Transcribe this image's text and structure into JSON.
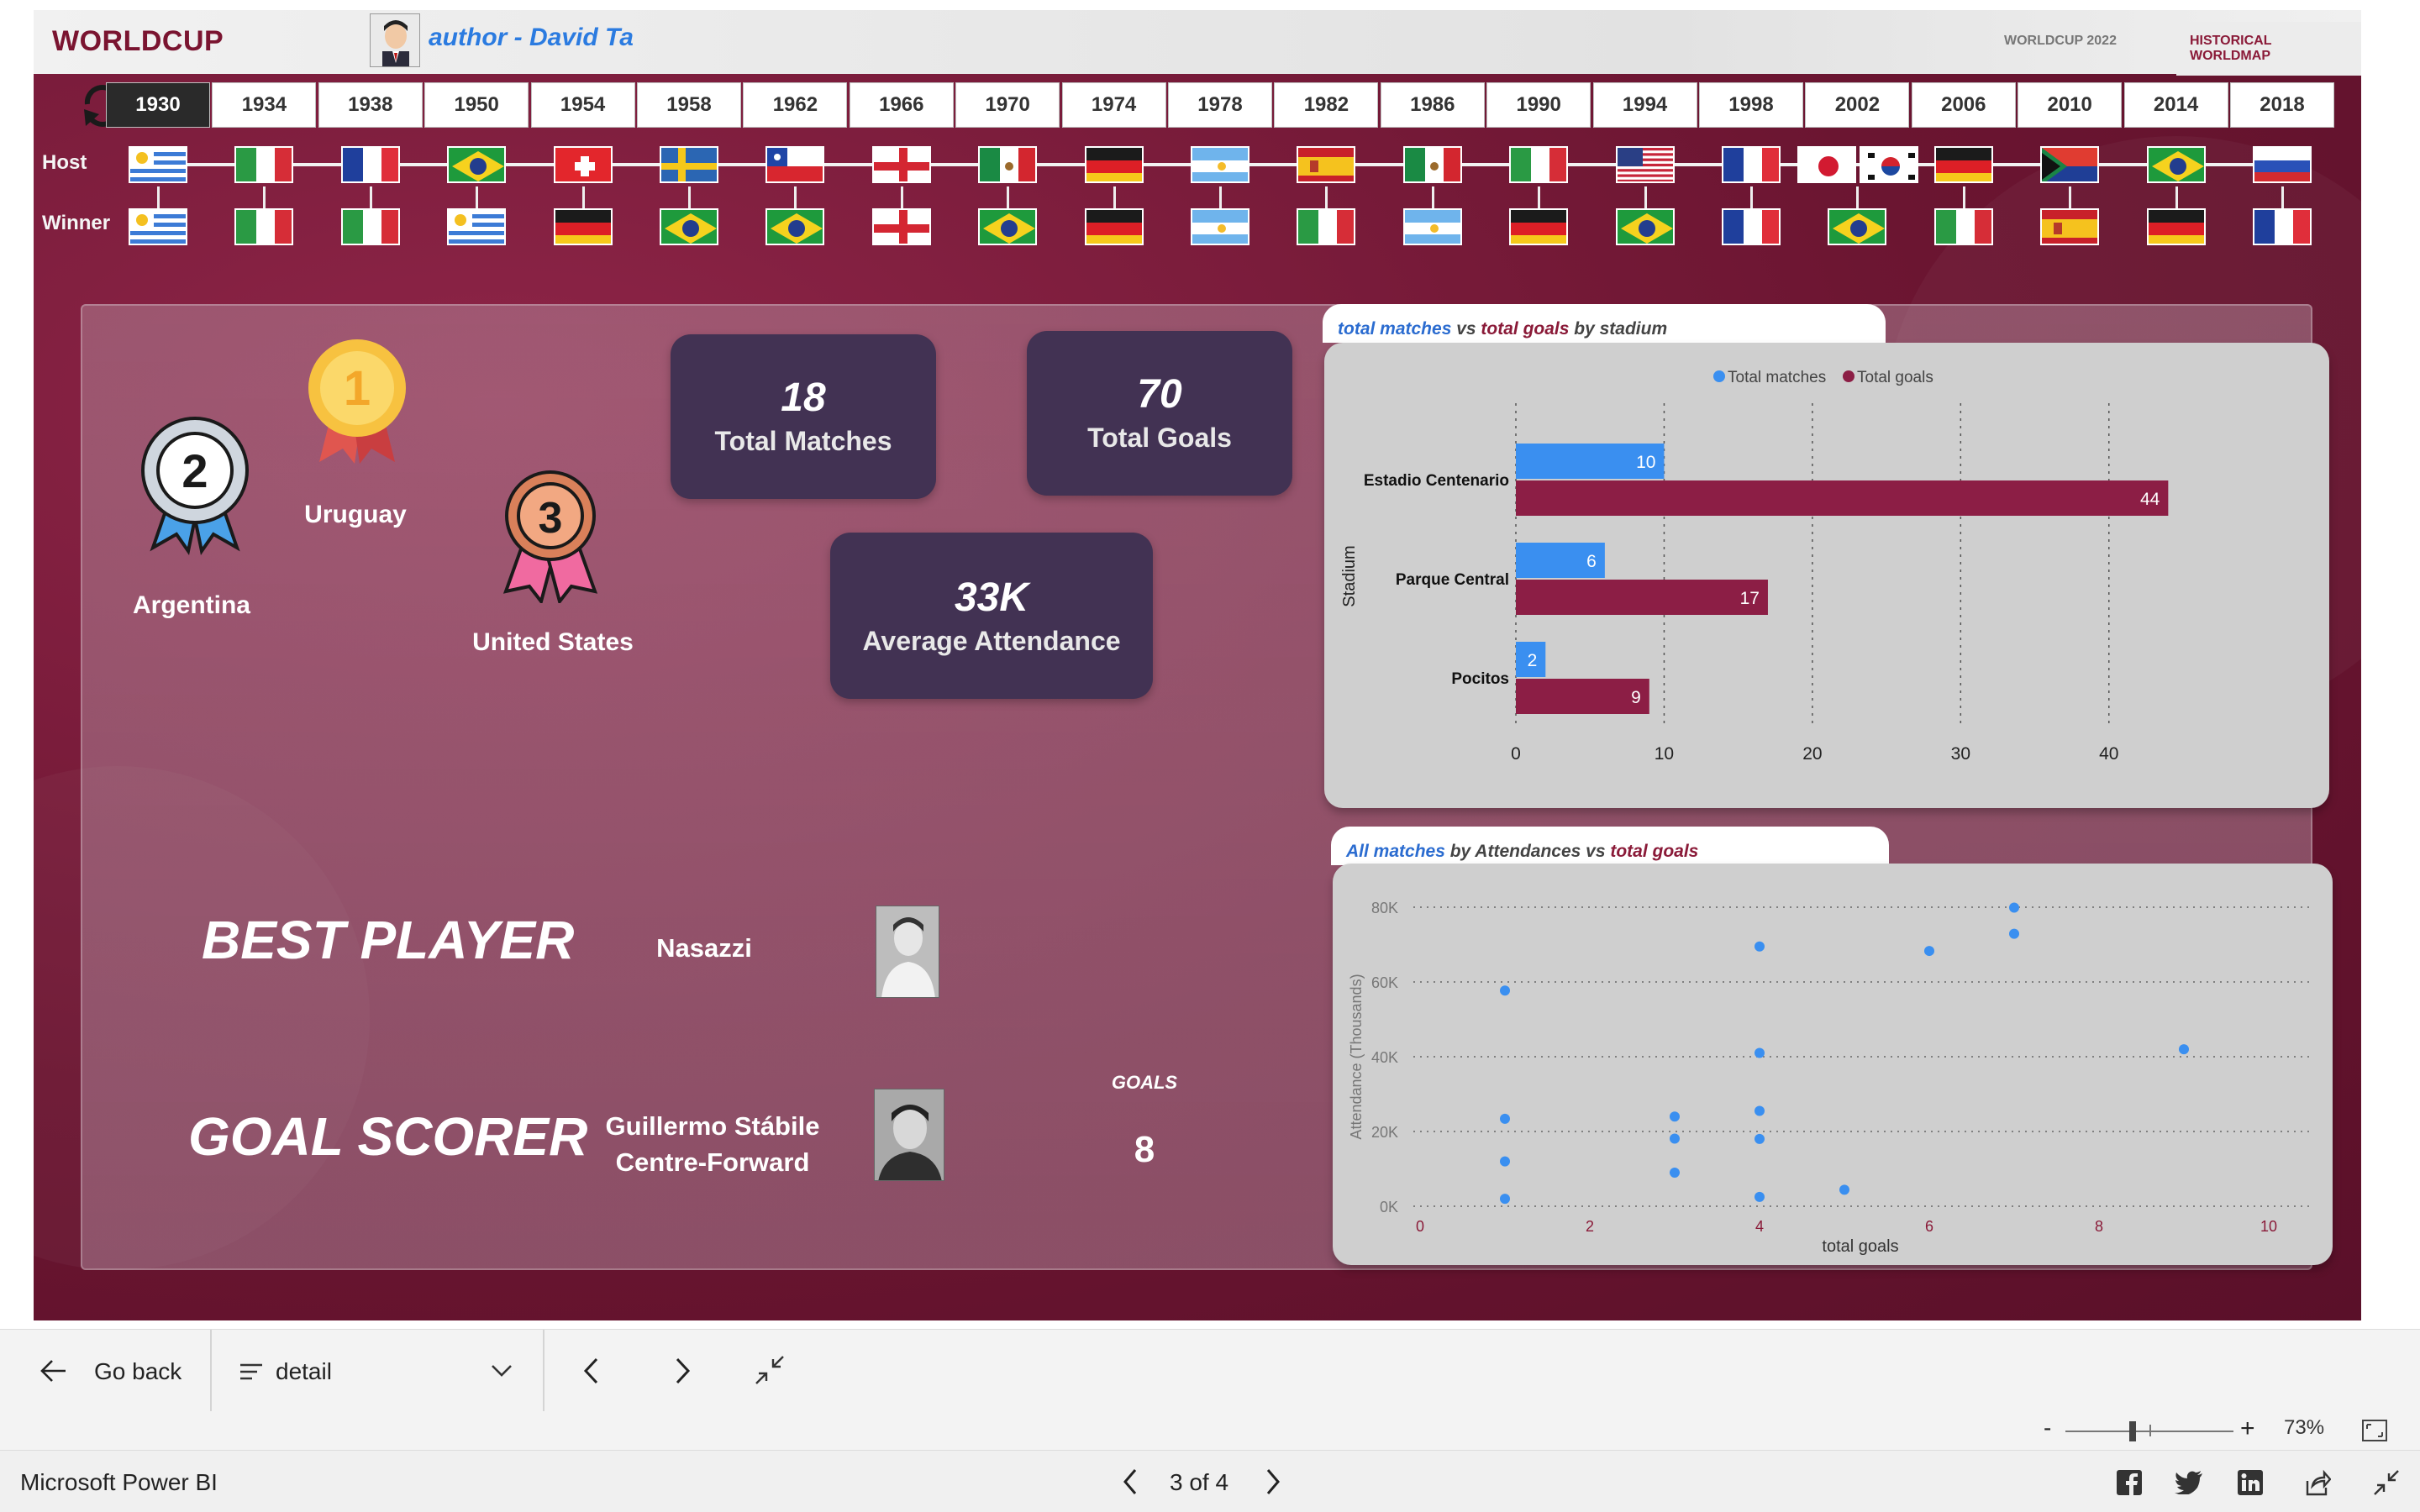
{
  "report": {
    "brand": "WORLDCUP",
    "author": "author - David Ta",
    "nav": [
      "WORLDCUP 2022",
      "HISTORICAL WORLDMAP"
    ],
    "years": [
      "1930",
      "1934",
      "1938",
      "1950",
      "1954",
      "1958",
      "1962",
      "1966",
      "1970",
      "1974",
      "1978",
      "1982",
      "1986",
      "1990",
      "1994",
      "1998",
      "2002",
      "2006",
      "2010",
      "2014",
      "2018"
    ],
    "selected_year": "1930",
    "host_label": "Host",
    "winner_label": "Winner",
    "hosts": [
      "uruguay",
      "italy",
      "france",
      "brazil",
      "switzerland",
      "sweden",
      "chile",
      "england",
      "mexico",
      "germany",
      "argentina",
      "spain",
      "mexico",
      "italy",
      "usa",
      "france",
      "japan+korea",
      "germany",
      "south-africa",
      "brazil",
      "russia"
    ],
    "winners": [
      "uruguay",
      "italy",
      "italy",
      "uruguay",
      "germany",
      "brazil",
      "brazil",
      "england",
      "brazil",
      "germany",
      "argentina",
      "italy",
      "argentina",
      "germany",
      "brazil",
      "france",
      "brazil",
      "italy",
      "spain",
      "germany",
      "france"
    ]
  },
  "podium": {
    "first": {
      "rank": "1",
      "team": "Uruguay"
    },
    "second": {
      "rank": "2",
      "team": "Argentina"
    },
    "third": {
      "rank": "3",
      "team": "United States"
    }
  },
  "kpis": {
    "matches": {
      "value": "18",
      "label": "Total Matches"
    },
    "goals": {
      "value": "70",
      "label": "Total Goals"
    },
    "attendance": {
      "value": "33K",
      "label": "Average Attendance"
    }
  },
  "best_player": {
    "heading": "BEST PLAYER",
    "name": "Nasazzi"
  },
  "goal_scorer": {
    "heading": "GOAL SCORER",
    "name": "Guillermo Stábile",
    "position": "Centre-Forward",
    "goals_label": "GOALS",
    "goals": "8"
  },
  "chart_titles": {
    "bar": {
      "a": "total matches",
      "b": " vs ",
      "c": "total goals",
      "d": " by stadium"
    },
    "scatter": {
      "a": "All matches",
      "b": " by Attendances ",
      "c": "vs",
      "d": " total goals"
    }
  },
  "colors": {
    "matches": "#3a8ff0",
    "goals": "#8c1e45",
    "scatter_point": "#3a8ff0"
  },
  "chart_data": [
    {
      "type": "bar",
      "orientation": "horizontal",
      "categories": [
        "Estadio Centenario",
        "Parque Central",
        "Pocitos"
      ],
      "series": [
        {
          "name": "Total matches",
          "values": [
            10,
            6,
            2
          ]
        },
        {
          "name": "Total goals",
          "values": [
            44,
            17,
            9
          ]
        }
      ],
      "xlim": [
        0,
        45
      ],
      "xticks": [
        0,
        10,
        20,
        30,
        40
      ],
      "ylabel": "Stadium",
      "legend": "top-center",
      "grid": true
    },
    {
      "type": "scatter",
      "xlabel": "total goals",
      "ylabel": "Attendance (Thousands)",
      "xlim": [
        0,
        10
      ],
      "ylim": [
        0,
        80000
      ],
      "xticks": [
        "0",
        "2",
        "4",
        "6",
        "8",
        "10"
      ],
      "yticks": [
        "0K",
        "20K",
        "40K",
        "60K",
        "80K"
      ],
      "points": [
        {
          "x": 1,
          "y": 57700
        },
        {
          "x": 1,
          "y": 23400
        },
        {
          "x": 1,
          "y": 12000
        },
        {
          "x": 1,
          "y": 2000
        },
        {
          "x": 3,
          "y": 24000
        },
        {
          "x": 3,
          "y": 18100
        },
        {
          "x": 3,
          "y": 9000
        },
        {
          "x": 4,
          "y": 69500
        },
        {
          "x": 4,
          "y": 41000
        },
        {
          "x": 4,
          "y": 25500
        },
        {
          "x": 4,
          "y": 18000
        },
        {
          "x": 4,
          "y": 2500
        },
        {
          "x": 5,
          "y": 4400
        },
        {
          "x": 6,
          "y": 68300
        },
        {
          "x": 7,
          "y": 79900
        },
        {
          "x": 7,
          "y": 72900
        },
        {
          "x": 9,
          "y": 42000
        }
      ],
      "grid": true
    }
  ],
  "footer": {
    "go_back": "Go back",
    "page_name": "detail",
    "zoom": "73%",
    "zoom_level": 0.4,
    "app_name": "Microsoft Power BI",
    "page_indicator": "3 of 4"
  }
}
